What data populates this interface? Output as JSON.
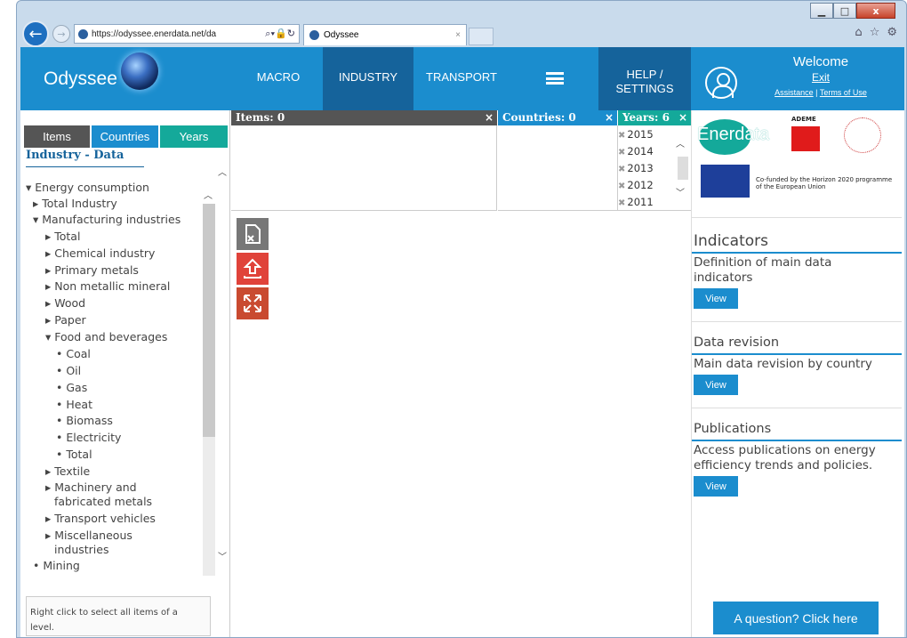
{
  "browser": {
    "url": "https://odyssee.enerdata.net/da",
    "tab_title": "Odyssee",
    "tab_close": "×",
    "minimize": "▁",
    "maximize": "□",
    "close": "x"
  },
  "topnav": {
    "logo": "Odyssee",
    "items": [
      "MACRO",
      "INDUSTRY",
      "TRANSPORT"
    ],
    "help_line1": "HELP /",
    "help_line2": "SETTINGS",
    "welcome": "Welcome",
    "exit": "Exit",
    "assistance": "Assistance",
    "separator": " | ",
    "terms": "Terms of Use"
  },
  "left": {
    "tabs": [
      "Items",
      "Countries",
      "Years"
    ],
    "title": "Industry - Data",
    "tree": [
      "▾ Energy consumption",
      "▸ Total Industry",
      "▾ Manufacturing industries",
      "▸ Total",
      "▸ Chemical industry",
      "▸ Primary metals",
      "▸ Non metallic mineral",
      "▸ Wood",
      "▸ Paper",
      "▾ Food and beverages",
      "• Coal",
      "• Oil",
      "• Gas",
      "• Heat",
      "• Biomass",
      "• Electricity",
      "• Total",
      "▸ Textile",
      "▸ Machinery and",
      "fabricated metals",
      "▸ Transport vehicles",
      "▸ Miscellaneous",
      "industries",
      "• Mining"
    ],
    "hint_line1": "Right click to select all items of a",
    "hint_line2": "level."
  },
  "selection": {
    "items_header": "Items: 0",
    "countries_header": "Countries: 0",
    "years_header": "Years: 6",
    "close": "×",
    "years": [
      "2015",
      "2014",
      "2013",
      "2012",
      "2011"
    ],
    "remove": "✖"
  },
  "right": {
    "enerdata_logo": "Enerdata",
    "ademe": "ADEME",
    "eu_text_line1": "Co-funded by the Horizon 2020 programme",
    "eu_text_line2": "of the European Union",
    "indicators_title": "Indicators",
    "indicators_desc": "Definition of main data indicators",
    "revision_title": "Data revision",
    "revision_desc": "Main data revision by country",
    "publications_title": "Publications",
    "publications_desc": "Access publications on energy efficiency trends and policies.",
    "view": "View",
    "question": "A question? Click here"
  },
  "colors": {
    "brand_blue": "#1b8dce",
    "active_blue": "#15639b",
    "teal": "#14a99a",
    "items_header_gray": "#555555",
    "tool_red": "#e0433a"
  }
}
